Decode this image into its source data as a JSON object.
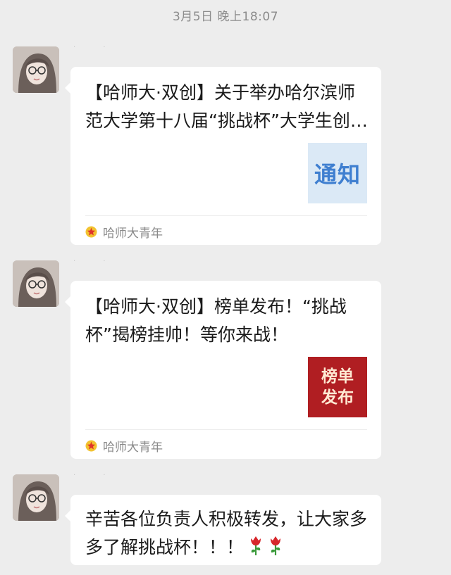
{
  "timestamp": "3月5日 晚上18:07",
  "messages": [
    {
      "type": "article-card",
      "title": "【哈师大·双创】关于举办哈尔滨师范大学第十八届“挑战杯”大学生创业计划竞赛的通知",
      "thumb_text": "通知",
      "source": "哈师大青年"
    },
    {
      "type": "article-card",
      "title": "【哈师大·双创】榜单发布！“挑战杯”揭榜挂帅！等你来战！",
      "thumb_lines": [
        "榜单",
        "发布"
      ],
      "source": "哈师大青年"
    },
    {
      "type": "text",
      "text": "辛苦各位负责人积极转发，让大家多多了解挑战杯！！！",
      "emoji": [
        "rose-emoji",
        "rose-emoji"
      ]
    }
  ],
  "colors": {
    "background": "#ededed",
    "bubble": "#ffffff",
    "thumb_notice_bg": "#dbe9f6",
    "thumb_notice_text": "#3f7fd0",
    "thumb_rank_bg": "#b01e22",
    "source_icon": "#e0342a"
  }
}
